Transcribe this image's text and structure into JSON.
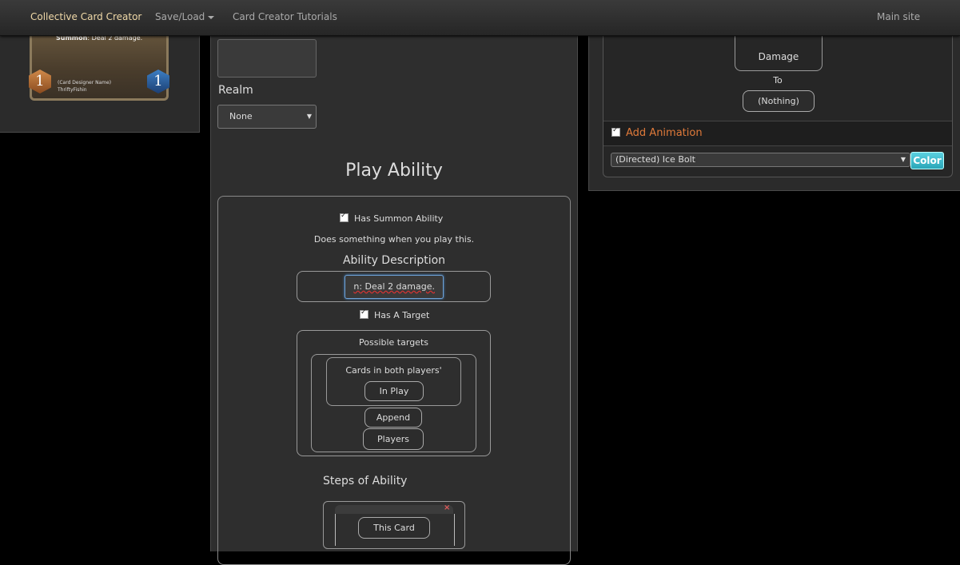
{
  "nav": {
    "brand": "Collective Card Creator",
    "save_load": "Save/Load",
    "tutorials": "Card Creator Tutorials",
    "main_site": "Main site"
  },
  "card_preview": {
    "keyword": "Summon",
    "text": ": Deal 2 damage.",
    "mana_cost": "1",
    "stat": "1",
    "designer_label": "(Card Designer Name)",
    "designer_name": "ThriftyFishin"
  },
  "editor": {
    "realm_label": "Realm",
    "realm_value": "None",
    "play_ability_title": "Play Ability",
    "has_summon_label": "Has Summon Ability",
    "summon_desc": "Does something when you play this.",
    "ability_desc_label": "Ability Description",
    "ability_desc_value": "n: Deal 2 damage.",
    "has_target_label": "Has A Target",
    "possible_targets_label": "Possible targets",
    "cards_in_both": "Cards in both players'",
    "in_play": "In Play",
    "append": "Append",
    "players": "Players",
    "steps_label": "Steps of Ability",
    "close_glyph": "×",
    "this_card": "This Card"
  },
  "right": {
    "damage": "Damage",
    "to": "To",
    "nothing": "(Nothing)",
    "add_animation": "Add Animation",
    "animation_value": "(Directed) Ice Bolt",
    "color_button": "Color"
  },
  "colors": {
    "accent_orange": "#e07a3a",
    "color_button": "#2aa6b8",
    "brand": "#f0d9a8"
  }
}
